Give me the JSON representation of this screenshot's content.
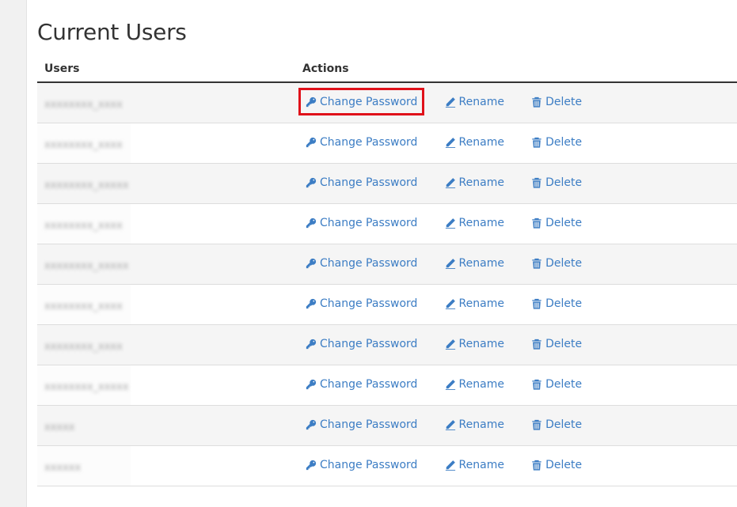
{
  "page": {
    "title": "Current Users"
  },
  "table": {
    "columns": {
      "users": "Users",
      "actions": "Actions"
    },
    "actions": {
      "change_password": "Change Password",
      "rename": "Rename",
      "delete": "Delete"
    },
    "rows": [
      {
        "username": "xxxxxxxx_xxxx",
        "highlighted": true
      },
      {
        "username": "xxxxxxxx_xxxx",
        "highlighted": false
      },
      {
        "username": "xxxxxxxx_xxxxx",
        "highlighted": false
      },
      {
        "username": "xxxxxxxx_xxxx",
        "highlighted": false
      },
      {
        "username": "xxxxxxxx_xxxxx",
        "highlighted": false
      },
      {
        "username": "xxxxxxxx_xxxx",
        "highlighted": false
      },
      {
        "username": "xxxxxxxx_xxxx",
        "highlighted": false
      },
      {
        "username": "xxxxxxxx_xxxxx",
        "highlighted": false
      },
      {
        "username": "xxxxx",
        "highlighted": false
      },
      {
        "username": "xxxxxx",
        "highlighted": false
      }
    ]
  },
  "colors": {
    "link": "#3c7dc4",
    "highlight": "#e0111a",
    "stripe": "#f5f5f5",
    "header_rule": "#333333"
  },
  "icons": {
    "change_password": "key-icon",
    "rename": "pencil-icon",
    "delete": "trash-icon"
  }
}
